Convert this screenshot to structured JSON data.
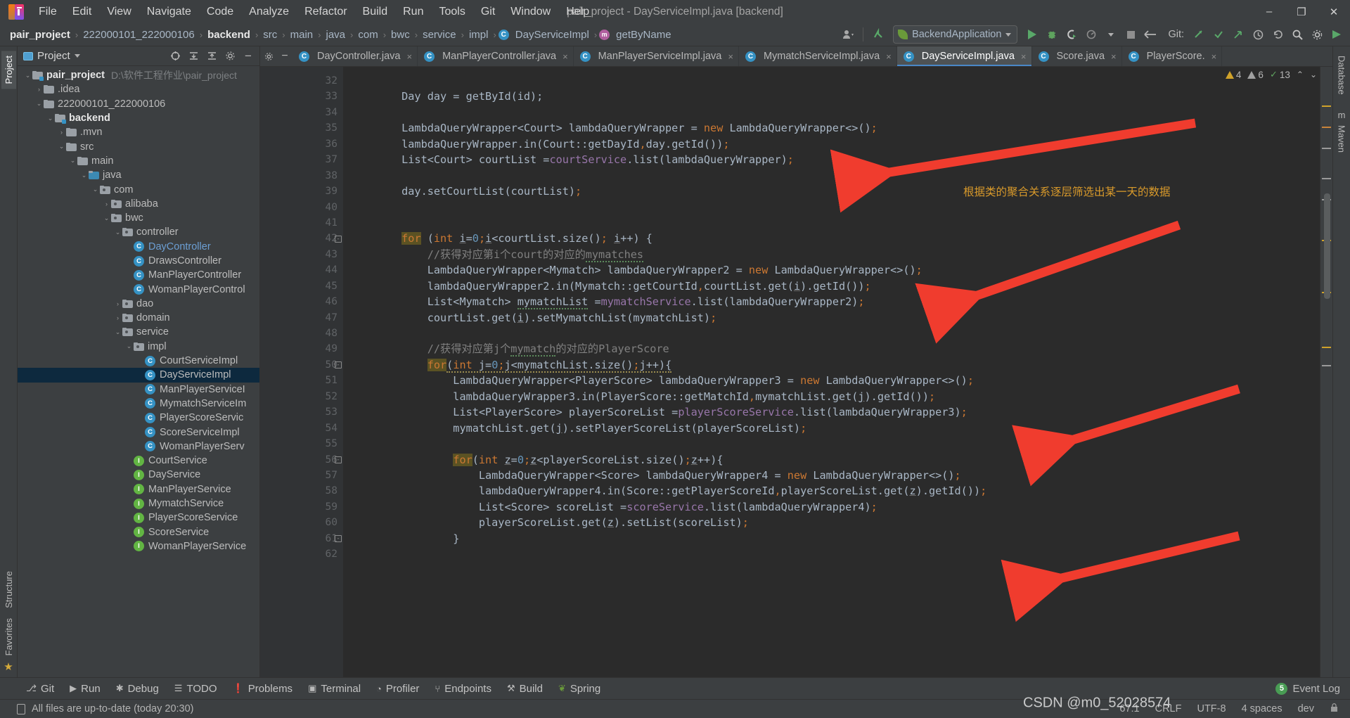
{
  "window": {
    "title": "pair_project - DayServiceImpl.java [backend]",
    "minimize": "–",
    "maximize": "❐",
    "close": "✕"
  },
  "menu": {
    "items": [
      "File",
      "Edit",
      "View",
      "Navigate",
      "Code",
      "Analyze",
      "Refactor",
      "Build",
      "Run",
      "Tools",
      "Git",
      "Window",
      "Help"
    ]
  },
  "breadcrumb": {
    "items": [
      {
        "label": "pair_project",
        "bold": true,
        "icon": ""
      },
      {
        "label": "222000101_222000106",
        "bold": false,
        "icon": ""
      },
      {
        "label": "backend",
        "bold": true,
        "icon": ""
      },
      {
        "label": "src",
        "bold": false,
        "icon": ""
      },
      {
        "label": "main",
        "bold": false,
        "icon": ""
      },
      {
        "label": "java",
        "bold": false,
        "icon": ""
      },
      {
        "label": "com",
        "bold": false,
        "icon": ""
      },
      {
        "label": "bwc",
        "bold": false,
        "icon": ""
      },
      {
        "label": "service",
        "bold": false,
        "icon": ""
      },
      {
        "label": "impl",
        "bold": false,
        "icon": ""
      },
      {
        "label": "DayServiceImpl",
        "bold": false,
        "icon": "class"
      },
      {
        "label": "getByName",
        "bold": false,
        "icon": "method"
      }
    ],
    "separator": "›"
  },
  "toolbar": {
    "run_config": "BackendApplication",
    "git_label": "Git:",
    "icons": {
      "profile": "user-icon",
      "updates": "update-arrow-icon",
      "run": "run-icon",
      "debug": "debug-icon",
      "run_coverage": "run-with-coverage-icon",
      "profiler": "profiler-icon",
      "stop": "stop-icon",
      "back": "back-arrow-icon",
      "commit": "git-commit-icon",
      "push": "git-push-icon",
      "update": "git-update-icon",
      "history": "history-icon",
      "undo": "undo-icon",
      "search": "search-icon",
      "settings": "settings-icon",
      "ide_help": "ide-help-icon"
    }
  },
  "left_rail": {
    "items": [
      "Project",
      "Structure",
      "Favorites"
    ],
    "active": "Project",
    "bookmark_icon": "star-icon"
  },
  "right_rail": {
    "items": [
      "Database",
      "m",
      "Maven"
    ]
  },
  "project_panel": {
    "title": "Project",
    "header_icons": [
      "select-opened-file-icon",
      "expand-all-icon",
      "collapse-all-icon",
      "settings-icon",
      "hide-icon"
    ],
    "tree": [
      {
        "indent": 0,
        "arrow": "⌄",
        "icon": "module",
        "label": "pair_project",
        "bold": true,
        "path": "D:\\软件工程作业\\pair_project"
      },
      {
        "indent": 1,
        "arrow": "›",
        "icon": "folder",
        "label": ".idea",
        "bold": false,
        "path": ""
      },
      {
        "indent": 1,
        "arrow": "⌄",
        "icon": "folder",
        "label": "222000101_222000106",
        "bold": false,
        "path": ""
      },
      {
        "indent": 2,
        "arrow": "⌄",
        "icon": "module",
        "label": "backend",
        "bold": true,
        "path": ""
      },
      {
        "indent": 3,
        "arrow": "›",
        "icon": "folder",
        "label": ".mvn",
        "bold": false,
        "path": ""
      },
      {
        "indent": 3,
        "arrow": "⌄",
        "icon": "folder",
        "label": "src",
        "bold": false,
        "path": ""
      },
      {
        "indent": 4,
        "arrow": "⌄",
        "icon": "folder",
        "label": "main",
        "bold": false,
        "path": ""
      },
      {
        "indent": 5,
        "arrow": "⌄",
        "icon": "source",
        "label": "java",
        "bold": false,
        "path": ""
      },
      {
        "indent": 6,
        "arrow": "⌄",
        "icon": "package",
        "label": "com",
        "bold": false,
        "path": ""
      },
      {
        "indent": 7,
        "arrow": "›",
        "icon": "package",
        "label": "alibaba",
        "bold": false,
        "path": ""
      },
      {
        "indent": 7,
        "arrow": "⌄",
        "icon": "package",
        "label": "bwc",
        "bold": false,
        "path": ""
      },
      {
        "indent": 8,
        "arrow": "⌄",
        "icon": "package",
        "label": "controller",
        "bold": false,
        "path": ""
      },
      {
        "indent": 9,
        "arrow": "",
        "icon": "class",
        "label": "DayController",
        "bold": false,
        "blue": true,
        "path": ""
      },
      {
        "indent": 9,
        "arrow": "",
        "icon": "class",
        "label": "DrawsController",
        "bold": false,
        "path": ""
      },
      {
        "indent": 9,
        "arrow": "",
        "icon": "class",
        "label": "ManPlayerController",
        "bold": false,
        "path": ""
      },
      {
        "indent": 9,
        "arrow": "",
        "icon": "class",
        "label": "WomanPlayerControl",
        "bold": false,
        "path": ""
      },
      {
        "indent": 8,
        "arrow": "›",
        "icon": "package",
        "label": "dao",
        "bold": false,
        "path": ""
      },
      {
        "indent": 8,
        "arrow": "›",
        "icon": "package",
        "label": "domain",
        "bold": false,
        "path": ""
      },
      {
        "indent": 8,
        "arrow": "⌄",
        "icon": "package",
        "label": "service",
        "bold": false,
        "path": ""
      },
      {
        "indent": 9,
        "arrow": "⌄",
        "icon": "package",
        "label": "impl",
        "bold": false,
        "path": ""
      },
      {
        "indent": 10,
        "arrow": "",
        "icon": "class",
        "label": "CourtServiceImpl",
        "bold": false,
        "path": ""
      },
      {
        "indent": 10,
        "arrow": "",
        "icon": "class",
        "label": "DayServiceImpl",
        "bold": false,
        "selected": true,
        "path": ""
      },
      {
        "indent": 10,
        "arrow": "",
        "icon": "class",
        "label": "ManPlayerServiceI",
        "bold": false,
        "path": ""
      },
      {
        "indent": 10,
        "arrow": "",
        "icon": "class",
        "label": "MymatchServiceIm",
        "bold": false,
        "path": ""
      },
      {
        "indent": 10,
        "arrow": "",
        "icon": "class",
        "label": "PlayerScoreServic",
        "bold": false,
        "path": ""
      },
      {
        "indent": 10,
        "arrow": "",
        "icon": "class",
        "label": "ScoreServiceImpl",
        "bold": false,
        "path": ""
      },
      {
        "indent": 10,
        "arrow": "",
        "icon": "class",
        "label": "WomanPlayerServ",
        "bold": false,
        "path": ""
      },
      {
        "indent": 9,
        "arrow": "",
        "icon": "interface",
        "label": "CourtService",
        "bold": false,
        "path": ""
      },
      {
        "indent": 9,
        "arrow": "",
        "icon": "interface",
        "label": "DayService",
        "bold": false,
        "path": ""
      },
      {
        "indent": 9,
        "arrow": "",
        "icon": "interface",
        "label": "ManPlayerService",
        "bold": false,
        "path": ""
      },
      {
        "indent": 9,
        "arrow": "",
        "icon": "interface",
        "label": "MymatchService",
        "bold": false,
        "path": ""
      },
      {
        "indent": 9,
        "arrow": "",
        "icon": "interface",
        "label": "PlayerScoreService",
        "bold": false,
        "path": ""
      },
      {
        "indent": 9,
        "arrow": "",
        "icon": "interface",
        "label": "ScoreService",
        "bold": false,
        "path": ""
      },
      {
        "indent": 9,
        "arrow": "",
        "icon": "interface",
        "label": "WomanPlayerService",
        "bold": false,
        "path": ""
      }
    ]
  },
  "editor_tabs": {
    "items": [
      {
        "label": "DayController.java",
        "active": false
      },
      {
        "label": "ManPlayerController.java",
        "active": false
      },
      {
        "label": "ManPlayerServiceImpl.java",
        "active": false
      },
      {
        "label": "MymatchServiceImpl.java",
        "active": false
      },
      {
        "label": "DayServiceImpl.java",
        "active": true
      },
      {
        "label": "Score.java",
        "active": false
      },
      {
        "label": "PlayerScore.",
        "active": false
      }
    ],
    "close_glyph": "×"
  },
  "inspections": {
    "errors": "4",
    "warnings": "6",
    "checks": "13",
    "chevron_up": "⌃",
    "chevron_down": "⌄"
  },
  "code": {
    "first_line": 32,
    "lines": [
      {
        "n": 32,
        "html": ""
      },
      {
        "n": 33,
        "html": "        Day day = getById(id);"
      },
      {
        "n": 34,
        "html": ""
      },
      {
        "n": 35,
        "html": "        LambdaQueryWrapper&lt;Court&gt; lambdaQueryWrapper = <span class=\"k\">new</span> LambdaQueryWrapper&lt;&gt;()<span class=\"sm\">;</span>"
      },
      {
        "n": 36,
        "html": "        lambdaQueryWrapper.in(Court::getDayId<span class=\"sm\">,</span>day.getId())<span class=\"sm\">;</span>"
      },
      {
        "n": 37,
        "html": "        List&lt;Court&gt; courtList =<span class=\"f\">courtService</span>.list(lambdaQueryWrapper)<span class=\"sm\">;</span>"
      },
      {
        "n": 38,
        "html": ""
      },
      {
        "n": 39,
        "html": "        day.setCourtList(courtList)<span class=\"sm\">;</span>"
      },
      {
        "n": 40,
        "html": ""
      },
      {
        "n": 41,
        "html": ""
      },
      {
        "n": 42,
        "html": "        <span class=\"kw-hl\">for</span> (<span class=\"k\">int</span> <span class=\"u\">i</span>=<span class=\"n\">0</span><span class=\"sm\">;</span><span class=\"u\">i</span>&lt;courtList.size()<span class=\"sm\">;</span> <span class=\"u\">i</span>++) {"
      },
      {
        "n": 43,
        "html": "            <span class=\"cm\">//获得对应第i个court的对应的<span class=\"sq\">mymatches</span></span>"
      },
      {
        "n": 44,
        "html": "            LambdaQueryWrapper&lt;Mymatch&gt; lambdaQueryWrapper2 = <span class=\"k\">new</span> LambdaQueryWrapper&lt;&gt;()<span class=\"sm\">;</span>"
      },
      {
        "n": 45,
        "html": "            lambdaQueryWrapper2.in(Mymatch::getCourtId<span class=\"sm\">,</span>courtList.get(<span class=\"u\">i</span>).getId())<span class=\"sm\">;</span>"
      },
      {
        "n": 46,
        "html": "            List&lt;Mymatch&gt; <span class=\"sq\">mymatchList</span> =<span class=\"f\">mymatchService</span>.list(lambdaQueryWrapper2)<span class=\"sm\">;</span>"
      },
      {
        "n": 47,
        "html": "            courtList.get(<span class=\"u\">i</span>).setMymatchList(mymatchList)<span class=\"sm\">;</span>"
      },
      {
        "n": 48,
        "html": ""
      },
      {
        "n": 49,
        "html": "            <span class=\"cm\">//获得对应第j个<span class=\"sq\">mymatch</span>的对应的PlayerScore</span>"
      },
      {
        "n": 50,
        "html": "            <span class=\"kw-hl\">for</span><span class=\"sqy\">(<span class=\"k\">int</span> j=<span class=\"n\">0</span><span class=\"sm\">;</span>j&lt;mymatchList.size()<span class=\"sm\">;</span>j++){</span>"
      },
      {
        "n": 51,
        "html": "                LambdaQueryWrapper&lt;PlayerScore&gt; lambdaQueryWrapper3 = <span class=\"k\">new</span> LambdaQueryWrapper&lt;&gt;()<span class=\"sm\">;</span>"
      },
      {
        "n": 52,
        "html": "                lambdaQueryWrapper3.in(PlayerScore::getMatchId<span class=\"sm\">,</span>mymatchList.get(<span class=\"u\">j</span>).getId())<span class=\"sm\">;</span>"
      },
      {
        "n": 53,
        "html": "                List&lt;PlayerScore&gt; playerScoreList =<span class=\"f\">playerScoreService</span>.list(lambdaQueryWrapper3)<span class=\"sm\">;</span>"
      },
      {
        "n": 54,
        "html": "                mymatchList.get(<span class=\"u\">j</span>).setPlayerScoreList(playerScoreList)<span class=\"sm\">;</span>"
      },
      {
        "n": 55,
        "html": ""
      },
      {
        "n": 56,
        "html": "                <span class=\"kw-hl\">for</span>(<span class=\"k\">int</span> <span class=\"u\">z</span>=<span class=\"n\">0</span><span class=\"sm\">;</span><span class=\"u\">z</span>&lt;playerScoreList.size()<span class=\"sm\">;</span><span class=\"u\">z</span>++){"
      },
      {
        "n": 57,
        "html": "                    LambdaQueryWrapper&lt;Score&gt; lambdaQueryWrapper4 = <span class=\"k\">new</span> LambdaQueryWrapper&lt;&gt;()<span class=\"sm\">;</span>"
      },
      {
        "n": 58,
        "html": "                    lambdaQueryWrapper4.in(Score::getPlayerScoreId<span class=\"sm\">,</span>playerScoreList.get(<span class=\"u\">z</span>).getId())<span class=\"sm\">;</span>"
      },
      {
        "n": 59,
        "html": "                    List&lt;Score&gt; scoreList =<span class=\"f\">scoreService</span>.list(lambdaQueryWrapper4)<span class=\"sm\">;</span>"
      },
      {
        "n": 60,
        "html": "                    playerScoreList.get(<span class=\"u\">z</span>).setList(scoreList)<span class=\"sm\">;</span>"
      },
      {
        "n": 61,
        "html": "                }"
      },
      {
        "n": 62,
        "html": ""
      }
    ]
  },
  "annotation": {
    "note_text": "根据类的聚合关系逐层筛选出某一天的数据",
    "note_color": "#d99a2b",
    "arrow_color": "#f03c2e",
    "arrow_count": 4
  },
  "tool_windows": {
    "items": [
      {
        "label": "Git",
        "icon": "git-icon"
      },
      {
        "label": "Run",
        "icon": "run-icon"
      },
      {
        "label": "Debug",
        "icon": "debug-icon"
      },
      {
        "label": "TODO",
        "icon": "todo-icon"
      },
      {
        "label": "Problems",
        "icon": "problems-icon"
      },
      {
        "label": "Terminal",
        "icon": "terminal-icon"
      },
      {
        "label": "Profiler",
        "icon": "profiler-icon"
      },
      {
        "label": "Endpoints",
        "icon": "endpoints-icon"
      },
      {
        "label": "Build",
        "icon": "build-icon"
      },
      {
        "label": "Spring",
        "icon": "spring-icon"
      }
    ],
    "event_log": {
      "label": "Event Log",
      "count": "5"
    }
  },
  "status_bar": {
    "message": "All files are up-to-date (today 20:30)",
    "caret": "67:1",
    "line_sep": "CRLF",
    "encoding": "UTF-8",
    "indent": "4 spaces",
    "branch": "dev",
    "lock_icon": "lock-icon"
  },
  "watermark": "CSDN @m0_52028574"
}
